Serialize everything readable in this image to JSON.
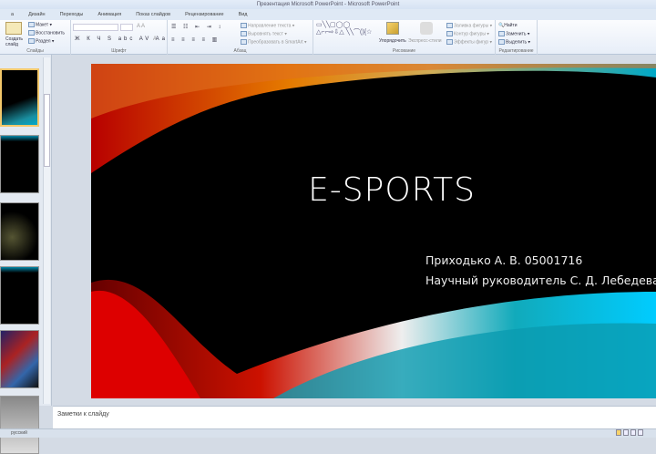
{
  "window": {
    "title": "Презентация Microsoft PowerPoint - Microsoft PowerPoint"
  },
  "tabs": [
    "а",
    "Дизайн",
    "Переходы",
    "Анимация",
    "Показ слайдов",
    "Рецензирование",
    "Вид"
  ],
  "ribbon": {
    "slides": {
      "label": "Слайды",
      "new_slide": "Создать слайд",
      "layout": "Макет",
      "reset": "Восстановить",
      "section": "Раздел"
    },
    "font": {
      "label": "Шрифт"
    },
    "paragraph": {
      "label": "Абзац",
      "text_direction": "Направление текста",
      "align_text": "Выровнять текст",
      "smartart": "Преобразовать в SmartArt"
    },
    "drawing": {
      "label": "Рисование",
      "arrange": "Упорядочить",
      "quick_styles": "Экспресс-стили",
      "shape_fill": "Заливка фигуры",
      "shape_outline": "Контур фигуры",
      "shape_effects": "Эффекты фигур"
    },
    "editing": {
      "label": "Редактирование",
      "find": "Найти",
      "replace": "Заменить",
      "select": "Выделить"
    }
  },
  "slide": {
    "title": "E-SPORTS",
    "author": "Приходько А. В. 05001716",
    "supervisor": "Научный руководитель С. Д. Лебедева"
  },
  "notes": {
    "placeholder": "Заметки к слайду"
  },
  "status": {
    "language": "русский"
  },
  "colors": {
    "accent_select": "#f3c76a",
    "slide_bg": "#000000"
  }
}
